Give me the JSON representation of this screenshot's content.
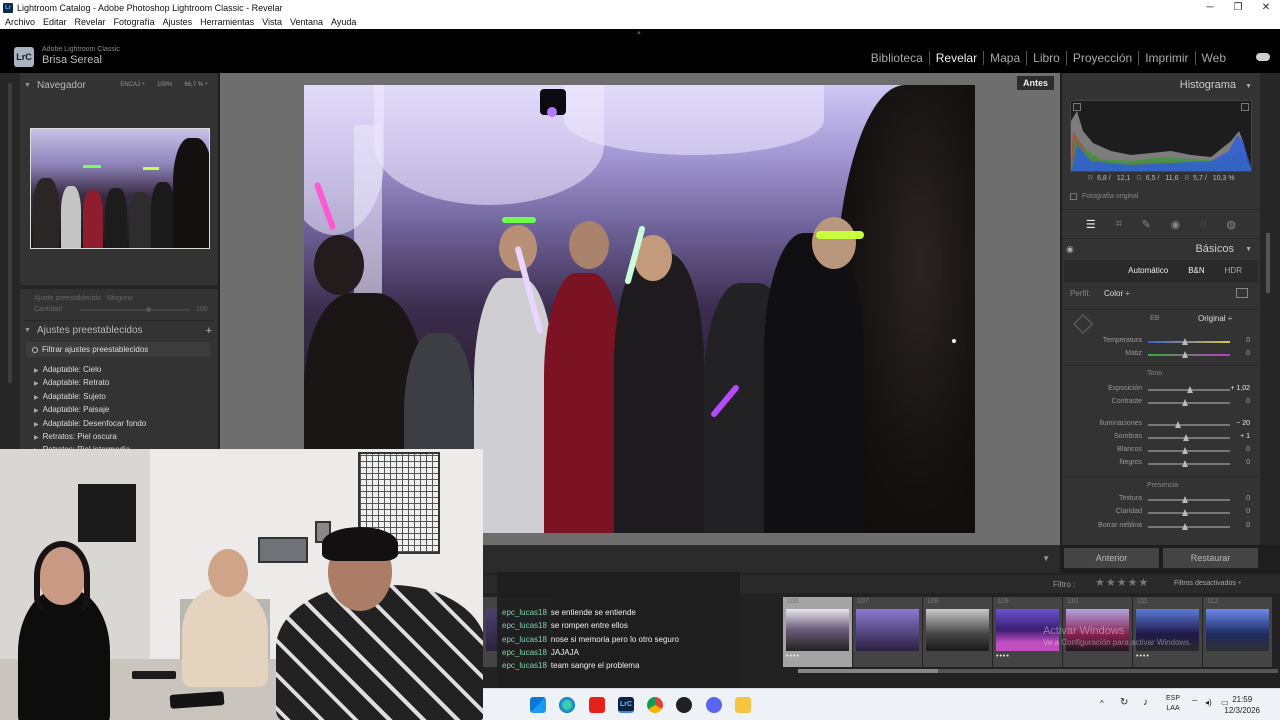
{
  "window": {
    "title": "Lightroom Catalog - Adobe Photoshop Lightroom Classic - Revelar",
    "controls": [
      "─",
      "❐",
      "✕"
    ]
  },
  "menu": [
    "Archivo",
    "Editar",
    "Revelar",
    "Fotografía",
    "Ajustes",
    "Herramientas",
    "Vista",
    "Ventana",
    "Ayuda"
  ],
  "identity": {
    "logo": "LrC",
    "product": "Adobe Lightroom Classic",
    "name": "Brisa Sereal"
  },
  "modules": [
    "Biblioteca",
    "Revelar",
    "Mapa",
    "Libro",
    "Proyección",
    "Imprimir",
    "Web"
  ],
  "active_module": "Revelar",
  "navigator": {
    "title": "Navegador",
    "options": [
      "ENCAJ ÷",
      "100%",
      "66,7 % ÷"
    ]
  },
  "preset_adjust": {
    "label": "Ajuste preestablecido",
    "value": "Ninguno",
    "amount_label": "Cantidad",
    "amount_value": "100"
  },
  "presets": {
    "title": "Ajustes preestablecidos",
    "filter_placeholder": "Filtrar ajustes preestablecidos",
    "items": [
      "Adaptable: Cielo",
      "Adaptable: Retrato",
      "Adaptable: Sujeto",
      "Adaptable: Paisaje",
      "Adaptable: Desenfocar fondo",
      "Retratos: Piel oscura",
      "Retratos: Piel intermedia"
    ]
  },
  "before_label": "Antes",
  "histogram": {
    "title": "Histograma",
    "readout": [
      {
        "k": "R",
        "v": "6,8 /"
      },
      {
        "k": "",
        "v": "12,1"
      },
      {
        "k": "G",
        "v": "6,5 /"
      },
      {
        "k": "",
        "v": "11,6"
      },
      {
        "k": "B",
        "v": "5,7 /"
      },
      {
        "k": "",
        "v": "10,3 %"
      }
    ],
    "original_photo": "Fotografía original"
  },
  "basic": {
    "title": "Básicos",
    "treatments": [
      "Automático",
      "B&N",
      "HDR"
    ],
    "profile_label": "Perfil:",
    "profile_value": "Color ÷",
    "wb_label": "EB",
    "wb_value": "Original ÷",
    "tone_label": "Tono",
    "presence_label": "Presencia",
    "sliders": [
      {
        "label": "Temperatura",
        "value": "0",
        "pos": 0.45,
        "track": "linear-gradient(90deg,#3b5fd1,#d9c63b)"
      },
      {
        "label": "Matiz",
        "value": "0",
        "pos": 0.45,
        "track": "linear-gradient(90deg,#3ba83b,#c03bc0)"
      },
      {
        "label": "Exposición",
        "value": "+ 1,02",
        "pos": 0.51,
        "track": "#777",
        "active": true
      },
      {
        "label": "Contraste",
        "value": "0",
        "pos": 0.45,
        "track": "#777"
      },
      {
        "label": "Iluminaciones",
        "value": "− 20",
        "pos": 0.36,
        "track": "#777",
        "active": true
      },
      {
        "label": "Sombras",
        "value": "+ 1",
        "pos": 0.46,
        "track": "#777",
        "active": true
      },
      {
        "label": "Blancos",
        "value": "0",
        "pos": 0.45,
        "track": "#777"
      },
      {
        "label": "Negros",
        "value": "0",
        "pos": 0.45,
        "track": "#777"
      },
      {
        "label": "Textura",
        "value": "0",
        "pos": 0.45,
        "track": "#777"
      },
      {
        "label": "Claridad",
        "value": "0",
        "pos": 0.45,
        "track": "#777"
      },
      {
        "label": "Borrar neblina",
        "value": "0",
        "pos": 0.45,
        "track": "#777"
      }
    ]
  },
  "panel_buttons": {
    "previous": "Anterior",
    "reset": "Restaurar"
  },
  "filmstrip": {
    "filter_label": "Filtro :",
    "stars": "★★★★★",
    "filters_value": "Filtros desactivados ÷",
    "watermark_line1": "Activar Windows",
    "watermark_line2": "Ve a Configuración para activar Windows.",
    "cells": [
      {
        "num": "",
        "dots": ""
      },
      {
        "num": "106",
        "dots": "••••",
        "selected": true
      },
      {
        "num": "107",
        "dots": ""
      },
      {
        "num": "108",
        "dots": ""
      },
      {
        "num": "109",
        "dots": "••••"
      },
      {
        "num": "110",
        "dots": ""
      },
      {
        "num": "111",
        "dots": "••••"
      },
      {
        "num": "112",
        "dots": ""
      }
    ]
  },
  "chat": [
    {
      "user": "epc_lucas18",
      "msg": "se entiende se entiende"
    },
    {
      "user": "epc_lucas18",
      "msg": "se rompen entre ellos"
    },
    {
      "user": "epc_lucas18",
      "msg": "nose si memoria pero lo otro seguro"
    },
    {
      "user": "epc_lucas18",
      "msg": "JAJAJA"
    },
    {
      "user": "epc_lucas18",
      "msg": "team sangre el problema"
    }
  ],
  "taskbar": {
    "lang_top": "ESP",
    "lang_bottom": "LAA",
    "time": "21:59",
    "date": "12/3/2026",
    "apps": [
      "start-button",
      "edge-icon",
      "youtube-icon",
      "lightroom-icon",
      "chrome-icon",
      "obs-icon",
      "discord-icon",
      "file-explorer-icon"
    ]
  }
}
